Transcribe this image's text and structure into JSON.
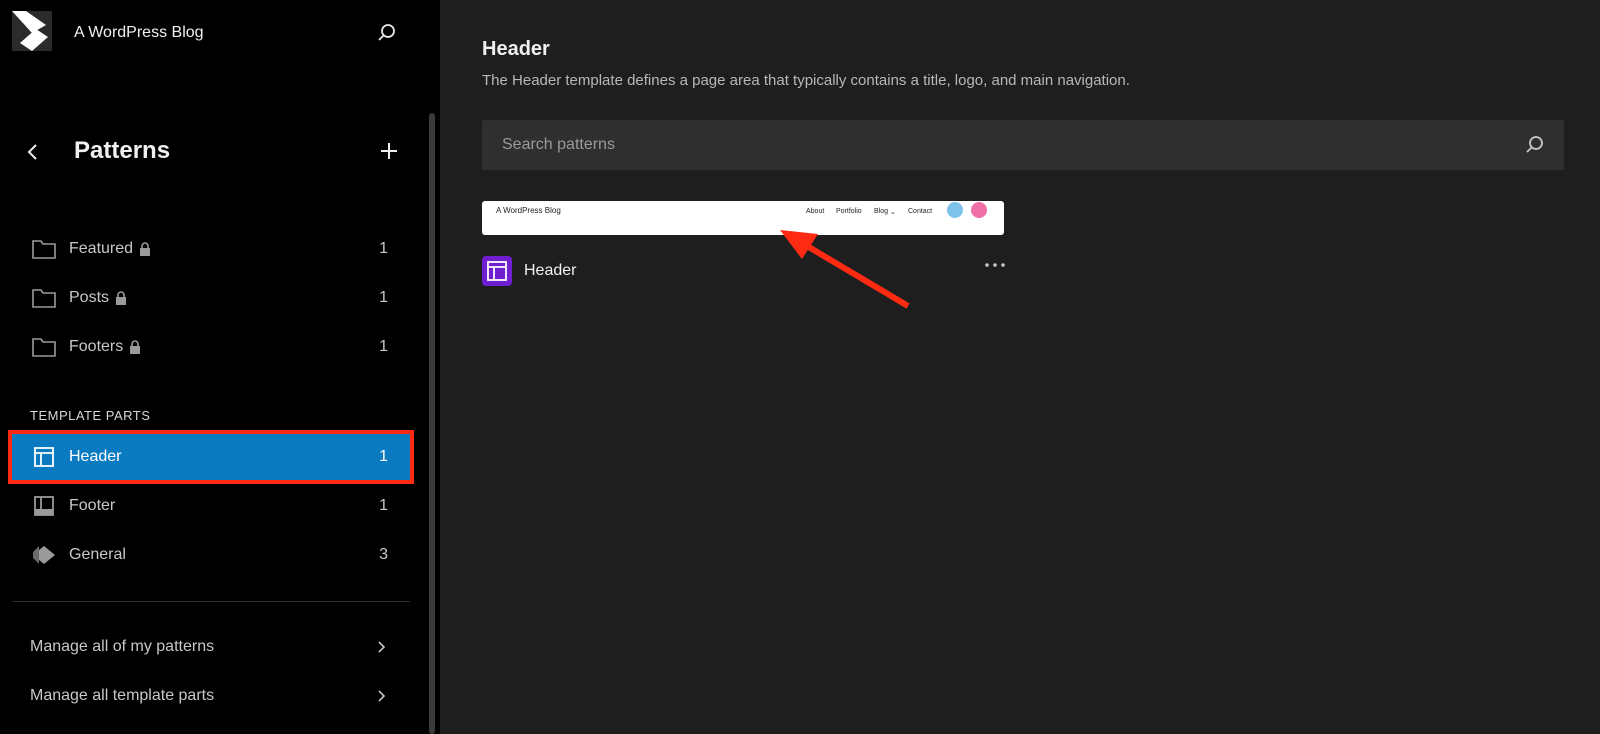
{
  "site_hub": {
    "site_title": "A WordPress Blog",
    "logo_icon": "wordpress-logo-icon",
    "search_icon": "search-icon"
  },
  "sidebar": {
    "title": "Patterns",
    "back_icon": "chevron-left-icon",
    "add_icon": "plus-icon",
    "categories": [
      {
        "label": "Featured",
        "count": "1",
        "icon": "folder-icon",
        "locked": true
      },
      {
        "label": "Posts",
        "count": "1",
        "icon": "folder-icon",
        "locked": true
      },
      {
        "label": "Footers",
        "count": "1",
        "icon": "folder-icon",
        "locked": true
      }
    ],
    "template_parts_label": "TEMPLATE PARTS",
    "template_parts": [
      {
        "label": "Header",
        "count": "1",
        "icon": "header-layout-icon",
        "active": true
      },
      {
        "label": "Footer",
        "count": "1",
        "icon": "footer-layout-icon",
        "active": false
      },
      {
        "label": "General",
        "count": "3",
        "icon": "symbol-diamond-icon",
        "active": false
      }
    ],
    "manage_links": [
      {
        "label": "Manage all of my patterns",
        "icon": "chevron-right-icon"
      },
      {
        "label": "Manage all template parts",
        "icon": "chevron-right-icon"
      }
    ]
  },
  "main": {
    "title": "Header",
    "description": "The Header template defines a page area that typically contains a title, logo, and main navigation.",
    "search": {
      "placeholder": "Search patterns",
      "icon": "search-icon"
    },
    "pattern": {
      "title": "Header",
      "icon": "header-layout-icon",
      "more_icon": "more-horizontal-icon",
      "preview": {
        "site_title": "A WordPress Blog",
        "nav": [
          "About",
          "Portfolio",
          "Blog",
          "Contact"
        ],
        "social": [
          "twitter-icon",
          "instagram-icon"
        ]
      }
    }
  },
  "colors": {
    "sidebar_bg": "#000000",
    "main_bg": "#1e1e1e",
    "active_item": "#0a7ac1",
    "highlight_box": "#ff2a12",
    "pattern_icon_bg": "#6f1fd0",
    "annotation_arrow": "#ff2a12"
  }
}
